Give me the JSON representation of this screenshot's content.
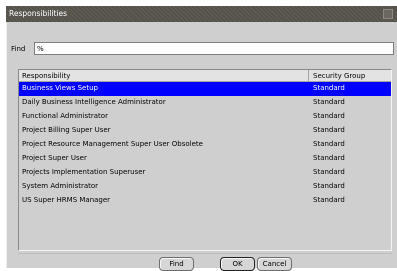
{
  "dialog": {
    "title": "Responsibilities"
  },
  "find": {
    "label": "Find",
    "value": "%"
  },
  "columns": {
    "responsibility": "Responsibility",
    "security_group": "Security Group"
  },
  "rows": [
    {
      "responsibility": "Business Views Setup",
      "security_group": "Standard",
      "selected": true
    },
    {
      "responsibility": "Daily Business Intelligence Administrator",
      "security_group": "Standard"
    },
    {
      "responsibility": "Functional Administrator",
      "security_group": "Standard"
    },
    {
      "responsibility": "Project Billing Super User",
      "security_group": "Standard"
    },
    {
      "responsibility": "Project Resource Management Super User Obsolete",
      "security_group": "Standard"
    },
    {
      "responsibility": "Project Super User",
      "security_group": "Standard"
    },
    {
      "responsibility": "Projects Implementation Superuser",
      "security_group": "Standard"
    },
    {
      "responsibility": "System Administrator",
      "security_group": "Standard"
    },
    {
      "responsibility": "US Super HRMS Manager",
      "security_group": "Standard"
    }
  ],
  "buttons": {
    "find": "Find",
    "ok": "OK",
    "cancel": "Cancel"
  },
  "colors": {
    "selection": "#0000ff",
    "titlebar": "#55524a",
    "background": "#cfcfcf"
  }
}
